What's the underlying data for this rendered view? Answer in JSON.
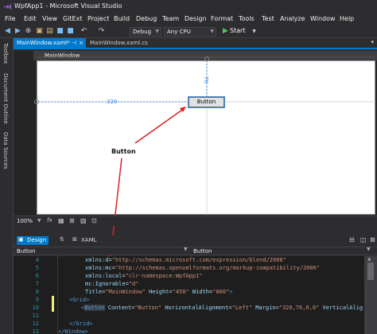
{
  "titlebar": {
    "title": "WpfApp1 - Microsoft Visual Studio"
  },
  "menubar": {
    "items": [
      "File",
      "Edit",
      "View",
      "GitExt",
      "Project",
      "Build",
      "Debug",
      "Team",
      "Design",
      "Format",
      "Tools",
      "Test",
      "Analyze",
      "Window",
      "Help"
    ]
  },
  "toolbar": {
    "configuration": "Debug",
    "platform": "Any CPU",
    "start_label": "Start"
  },
  "sidebar": {
    "items": [
      "Toolbox",
      "Document Outline",
      "Data Sources"
    ]
  },
  "doc_tabs": {
    "items": [
      "MainWindow.xaml*",
      "MainWindow.xaml.cs"
    ]
  },
  "designer": {
    "window_label": "MainWindow",
    "width_guide": "320",
    "height_guide": "76",
    "button_text": "Button",
    "annotation_label": "Button",
    "annotation_color": "#e02020",
    "selection_color": "#3e8ede"
  },
  "zoom": {
    "level": "100%"
  },
  "view_tabs": {
    "design": "Design",
    "xaml": "XAML"
  },
  "breadcrumb": {
    "left": "Button",
    "right": "Button"
  },
  "code_lines": [
    {
      "n": "4",
      "text": "xmlns:d=\"http://schemas.microsoft.com/expression/blend/2008\""
    },
    {
      "n": "5",
      "text": "xmlns:mc=\"http://schemas.openxmlformats.org/markup-compatibility/2006\""
    },
    {
      "n": "6",
      "text": "xmlns:local=\"clr-namespace:WpfApp1\""
    },
    {
      "n": "7",
      "text": "mc:Ignorable=\"d\""
    },
    {
      "n": "8",
      "text": "Title=\"MainWindow\" Height=\"450\" Width=\"800\">"
    },
    {
      "n": "9",
      "text": "<Grid>"
    },
    {
      "n": "10",
      "text": "<Button Content=\"Button\" HorizontalAlignment=\"Left\" Margin=\"320,76,0,0\" VerticalAlig"
    },
    {
      "n": "11",
      "text": ""
    },
    {
      "n": "12",
      "text": "</Grid>"
    },
    {
      "n": "13",
      "text": "</Window>"
    }
  ]
}
